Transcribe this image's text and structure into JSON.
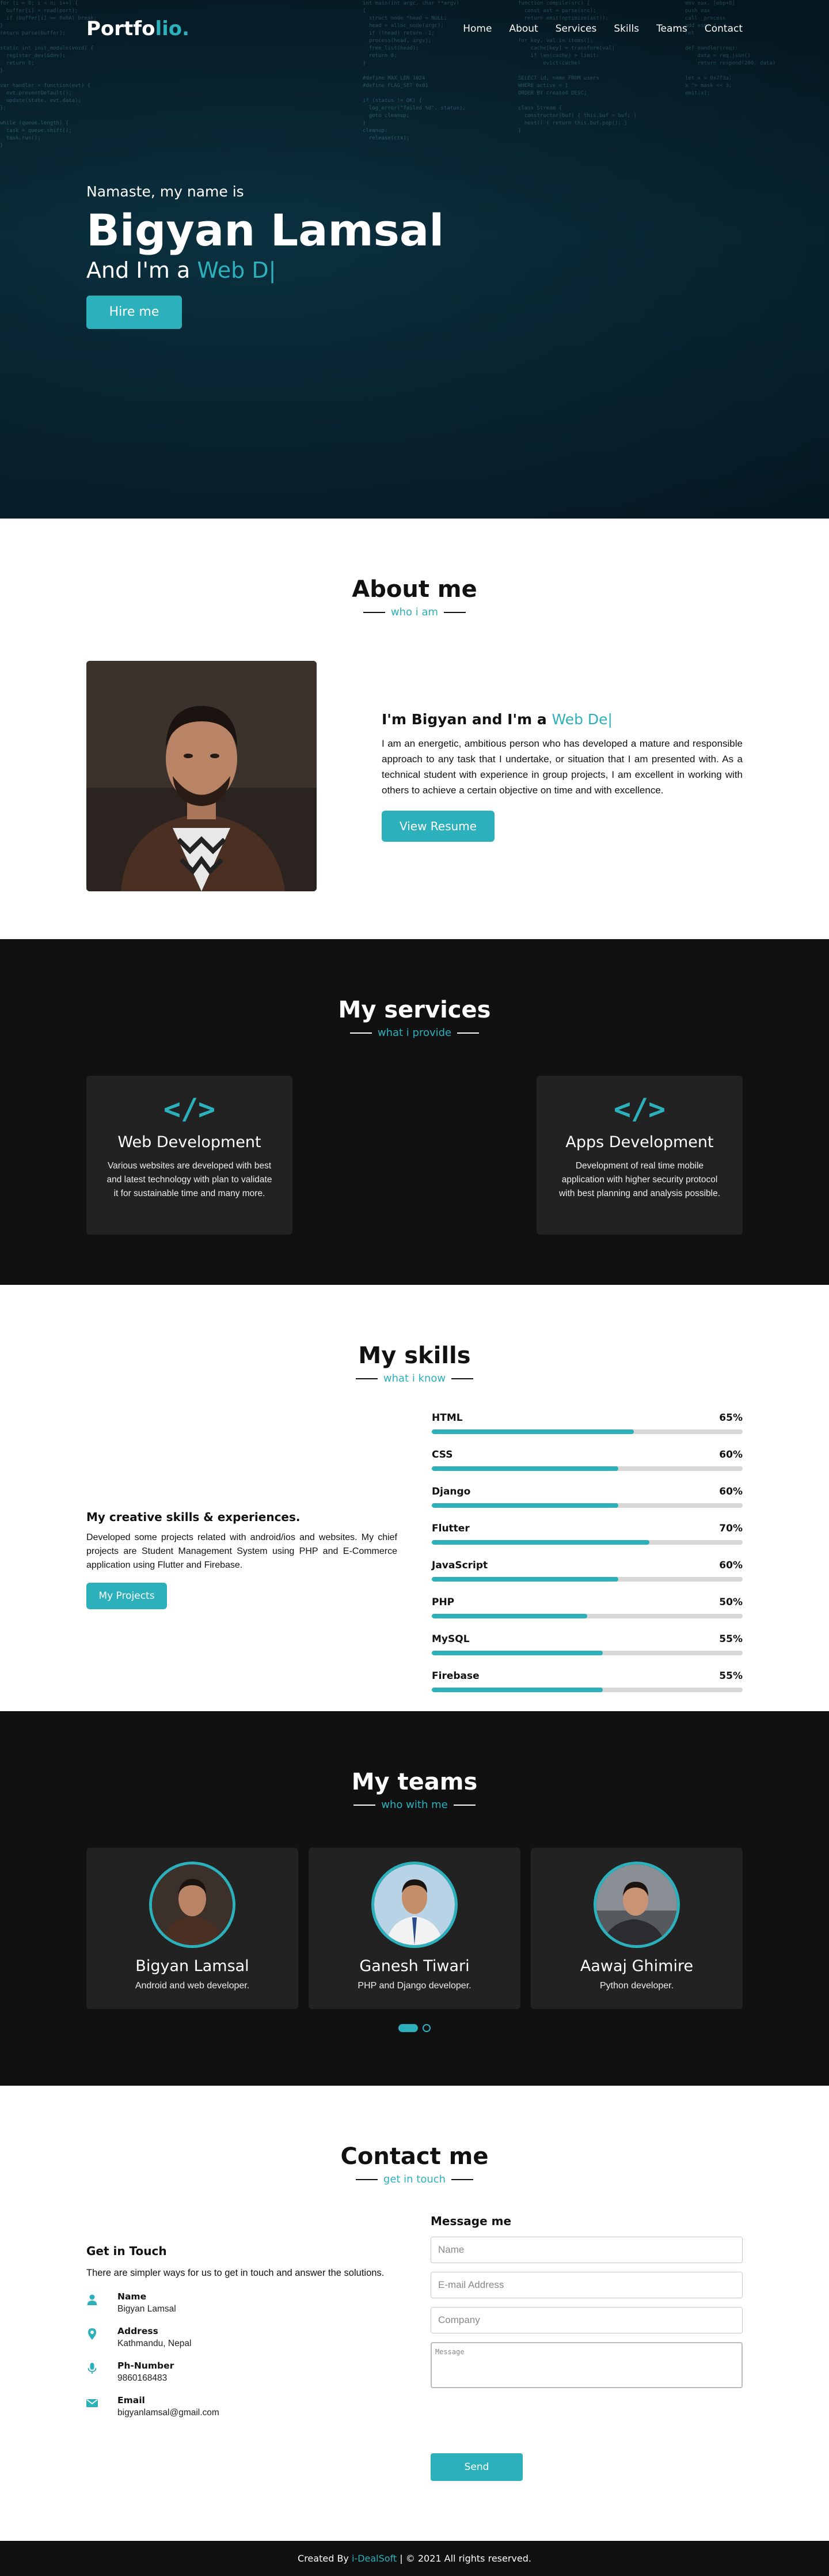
{
  "nav": {
    "logo_main": "Portfo",
    "logo_accent": "lio.",
    "items": [
      "Home",
      "About",
      "Services",
      "Skills",
      "Teams",
      "Contact"
    ]
  },
  "hero": {
    "greeting": "Namaste, my name is",
    "name": "Bigyan Lamsal",
    "role_prefix": "And I'm a",
    "role_typed": "Web D|",
    "hire_label": "Hire me"
  },
  "about": {
    "title": "About me",
    "subtitle": "who i am",
    "heading_prefix": "I'm Bigyan and I'm a",
    "heading_typed": "Web De|",
    "paragraph": "I am an energetic, ambitious person who has developed a mature and responsible approach to any task that I undertake, or situation that I am presented with. As a technical student with experience in group projects, I am excellent in working with others to achieve a certain objective on time and with excellence.",
    "resume_label": "View Resume"
  },
  "services": {
    "title": "My services",
    "subtitle": "what i provide",
    "icon": "code-icon",
    "icon_glyph": "</>",
    "cards": [
      {
        "title": "Web Development",
        "text": "Various websites are developed with best and latest technology with plan to validate it for sustainable time and many more."
      },
      {
        "title": "Apps Development",
        "text": "Development of real time mobile application with higher security protocol with best planning and analysis possible."
      }
    ]
  },
  "skills": {
    "title": "My skills",
    "subtitle": "what i know",
    "heading": "My creative skills & experiences.",
    "paragraph": "Developed some projects related with android/ios and websites. My chief projects are Student Management System using PHP and E-Commerce application using Flutter and Firebase.",
    "projects_label": "My Projects",
    "bars": [
      {
        "name": "HTML",
        "percent": "65%",
        "value": 65
      },
      {
        "name": "CSS",
        "percent": "60%",
        "value": 60
      },
      {
        "name": "Django",
        "percent": "60%",
        "value": 60
      },
      {
        "name": "Flutter",
        "percent": "70%",
        "value": 70
      },
      {
        "name": "JavaScript",
        "percent": "60%",
        "value": 60
      },
      {
        "name": "PHP",
        "percent": "50%",
        "value": 50
      },
      {
        "name": "MySQL",
        "percent": "55%",
        "value": 55
      },
      {
        "name": "Firebase",
        "percent": "55%",
        "value": 55
      }
    ]
  },
  "teams": {
    "title": "My teams",
    "subtitle": "who with me",
    "members": [
      {
        "name": "Bigyan Lamsal",
        "role": "Android and web developer."
      },
      {
        "name": "Ganesh Tiwari",
        "role": "PHP and Django developer."
      },
      {
        "name": "Aawaj Ghimire",
        "role": "Python developer."
      }
    ]
  },
  "contact": {
    "title": "Contact me",
    "subtitle": "get in touch",
    "left_heading": "Get in Touch",
    "left_text": "There are simpler ways for us to get in touch and answer the solutions.",
    "info": [
      {
        "icon": "person-icon",
        "label": "Name",
        "value": "Bigyan Lamsal"
      },
      {
        "icon": "location-pin-icon",
        "label": "Address",
        "value": "Kathmandu, Nepal"
      },
      {
        "icon": "microphone-icon",
        "label": "Ph-Number",
        "value": "9860168483"
      },
      {
        "icon": "email-icon",
        "label": "Email",
        "value": "bigyanlamsal@gmail.com"
      }
    ],
    "form_heading": "Message me",
    "name_placeholder": "Name",
    "email_placeholder": "E-mail Address",
    "company_placeholder": "Company",
    "message_placeholder": "Message",
    "send_label": "Send"
  },
  "footer": {
    "prefix": "Created By",
    "brand": "i-DealSoft",
    "suffix": "| © 2021 All rights reserved."
  },
  "colors": {
    "accent": "#2cb1bc",
    "dark_bg": "#111111",
    "card_bg": "#222222"
  }
}
